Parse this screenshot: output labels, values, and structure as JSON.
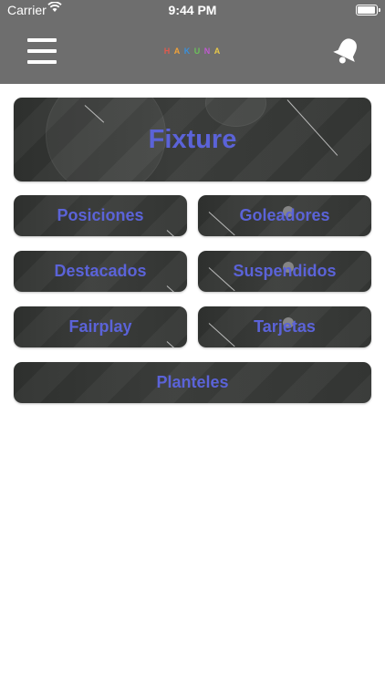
{
  "status": {
    "carrier": "Carrier",
    "time": "9:44 PM",
    "battery_level": 0.85
  },
  "nav": {
    "logo_letters": [
      "H",
      "A",
      "K",
      "U",
      "N",
      "A"
    ],
    "logo_colors": [
      "#e05a4e",
      "#f0a23a",
      "#3b8fd9",
      "#6cbf5a",
      "#c05ad0",
      "#e8c84a"
    ]
  },
  "menu": {
    "fixture": "Fixture",
    "posiciones": "Posiciones",
    "goleadores": "Goleadores",
    "destacados": "Destacados",
    "suspendidos": "Suspendidos",
    "fairplay": "Fairplay",
    "tarjetas": "Tarjetas",
    "planteles": "Planteles"
  },
  "colors": {
    "bar": "#6e6e6e",
    "tile_label": "#5b63d8"
  }
}
